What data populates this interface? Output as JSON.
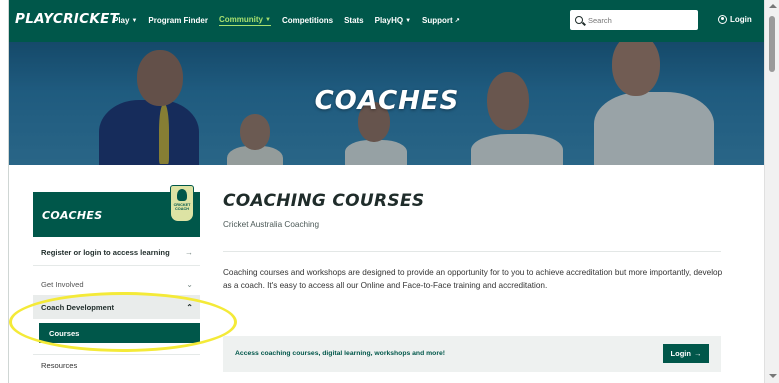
{
  "header": {
    "logo": "PLAYCRICKET",
    "nav": [
      {
        "label": "Play",
        "caret": true,
        "active": false
      },
      {
        "label": "Program Finder",
        "caret": false,
        "active": false
      },
      {
        "label": "Community",
        "caret": true,
        "active": true
      },
      {
        "label": "Competitions",
        "caret": false,
        "active": false
      },
      {
        "label": "Stats",
        "caret": false,
        "active": false
      },
      {
        "label": "PlayHQ",
        "caret": true,
        "active": false
      },
      {
        "label": "Support",
        "caret": false,
        "external": true,
        "active": false
      }
    ],
    "search_placeholder": "Search",
    "login_label": "Login"
  },
  "hero": {
    "title": "COACHES"
  },
  "sidebar": {
    "title": "COACHES",
    "items": {
      "register": "Register or login to access learning",
      "get_involved": "Get Involved",
      "coach_development": "Coach Development",
      "courses": "Courses",
      "resources": "Resources"
    }
  },
  "main": {
    "title": "COACHING COURSES",
    "subtitle": "Cricket Australia Coaching",
    "body": "Coaching courses and workshops are designed to provide an opportunity for to you to achieve accreditation but more importantly, develop as a coach. It's easy to access all our Online and Face-to-Face training and accreditation.",
    "cta_text": "Access coaching courses, digital learning, workshops and more!",
    "cta_button": "Login"
  },
  "colors": {
    "brand": "#00574a",
    "accent": "#a8e06f",
    "highlight": "#f4ea38"
  }
}
